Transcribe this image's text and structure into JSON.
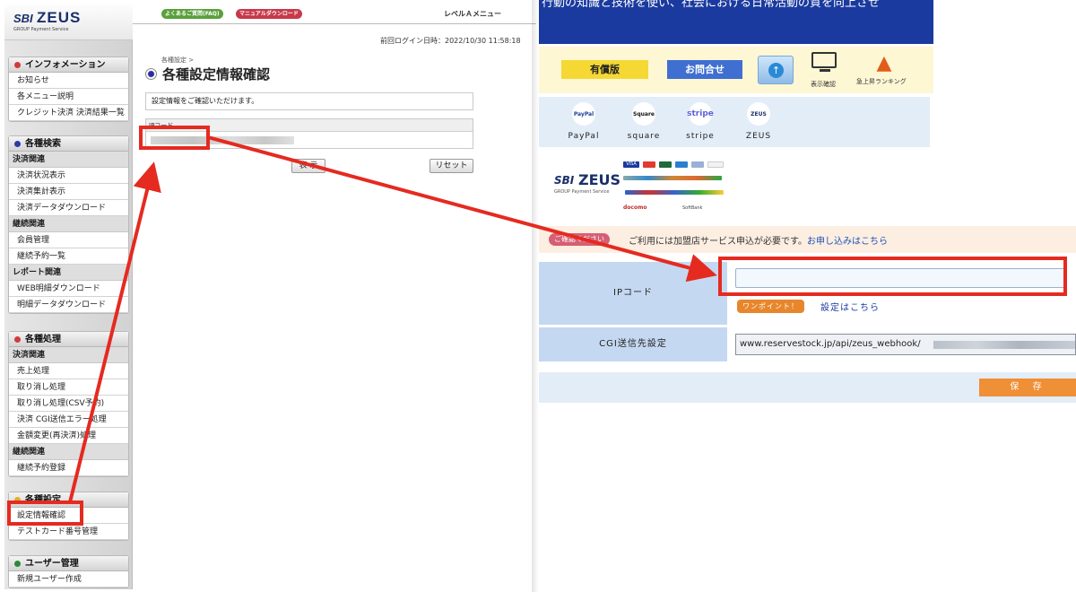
{
  "left": {
    "logo": {
      "brand": "SBI",
      "name": "ZEUS",
      "sub": "GROUP   Payment Service"
    },
    "top_buttons": {
      "faq": "よくあるご質問(FAQ)",
      "manual": "マニュアルダウンロード"
    },
    "level_menu": "レベルＡメニュー",
    "last_login": "前回ログイン日時：2022/10/30 11:58:18",
    "breadcrumb": "各種設定 >",
    "page_title": "各種設定情報確認",
    "info_text": "設定情報をご確認いただけます。",
    "ip_label": "IPコード",
    "buttons": {
      "show": "表 示",
      "reset": "リセット"
    },
    "sidebar": {
      "info": {
        "title": "インフォメーション",
        "items": [
          "お知らせ",
          "各メニュー説明",
          "クレジット決済 決済結果一覧"
        ]
      },
      "search": {
        "title": "各種検索",
        "sub1": "決済関連",
        "items1": [
          "決済状況表示",
          "決済集計表示",
          "決済データダウンロード"
        ],
        "sub2": "継続関連",
        "items2": [
          "会員管理",
          "継続予約一覧"
        ],
        "sub3": "レポート関連",
        "items3": [
          "WEB明細ダウンロード",
          "明細データダウンロード"
        ]
      },
      "process": {
        "title": "各種処理",
        "sub1": "決済関連",
        "items1": [
          "売上処理",
          "取り消し処理",
          "取り消し処理(CSV予約)",
          "決済 CGI送信エラー処理",
          "金額変更(再決済)処理"
        ],
        "sub2": "継続関連",
        "items2": [
          "継続予約登録"
        ]
      },
      "settings": {
        "title": "各種設定",
        "items": [
          "設定情報確認",
          "テストカード番号管理"
        ]
      },
      "users": {
        "title": "ユーザー管理",
        "items": [
          "新規ユーザー作成"
        ]
      }
    }
  },
  "right": {
    "banner_text": "行動の知識と技術を使い、社会における日常活動の質を向上させ",
    "toolbar": {
      "paid": "有償版",
      "contact": "お問合せ",
      "display": "表示確認",
      "ranking": "急上昇ランキング"
    },
    "payments": [
      {
        "icon": "PayPal",
        "name": "PayPal"
      },
      {
        "icon": "Square",
        "name": "square"
      },
      {
        "icon": "stripe",
        "name": "stripe"
      },
      {
        "icon": "ZEUS",
        "name": "ZEUS"
      }
    ],
    "zeus_logo": {
      "brand": "SBI",
      "name": "ZEUS",
      "sub": "GROUP   Payment Service"
    },
    "card_logos": [
      "VISA",
      "Mastercard",
      "JCB",
      "AMEX",
      "Diners",
      "DISCOVER"
    ],
    "wallet_logos": {
      "docomo": "docomo",
      "softbank": "SoftBank"
    },
    "notice": {
      "pill": "ご確認ください",
      "text": "ご利用には加盟店サービス申込が必要です。",
      "link": "お申し込みはこちら"
    },
    "form": {
      "ip_label": "IPコード",
      "ip_value": "",
      "onepoint": "ワンポイント！",
      "setting_link": "設定はこちら",
      "cgi_label": "CGI送信先設定",
      "cgi_value": "www.reservestock.jp/api/zeus_webhook/"
    },
    "save": "保 存"
  },
  "colors": {
    "annotation_red": "#e52a20",
    "banner_blue": "#1a3a9f",
    "form_label_blue": "#c5d8f1",
    "save_orange": "#ef8f36"
  }
}
